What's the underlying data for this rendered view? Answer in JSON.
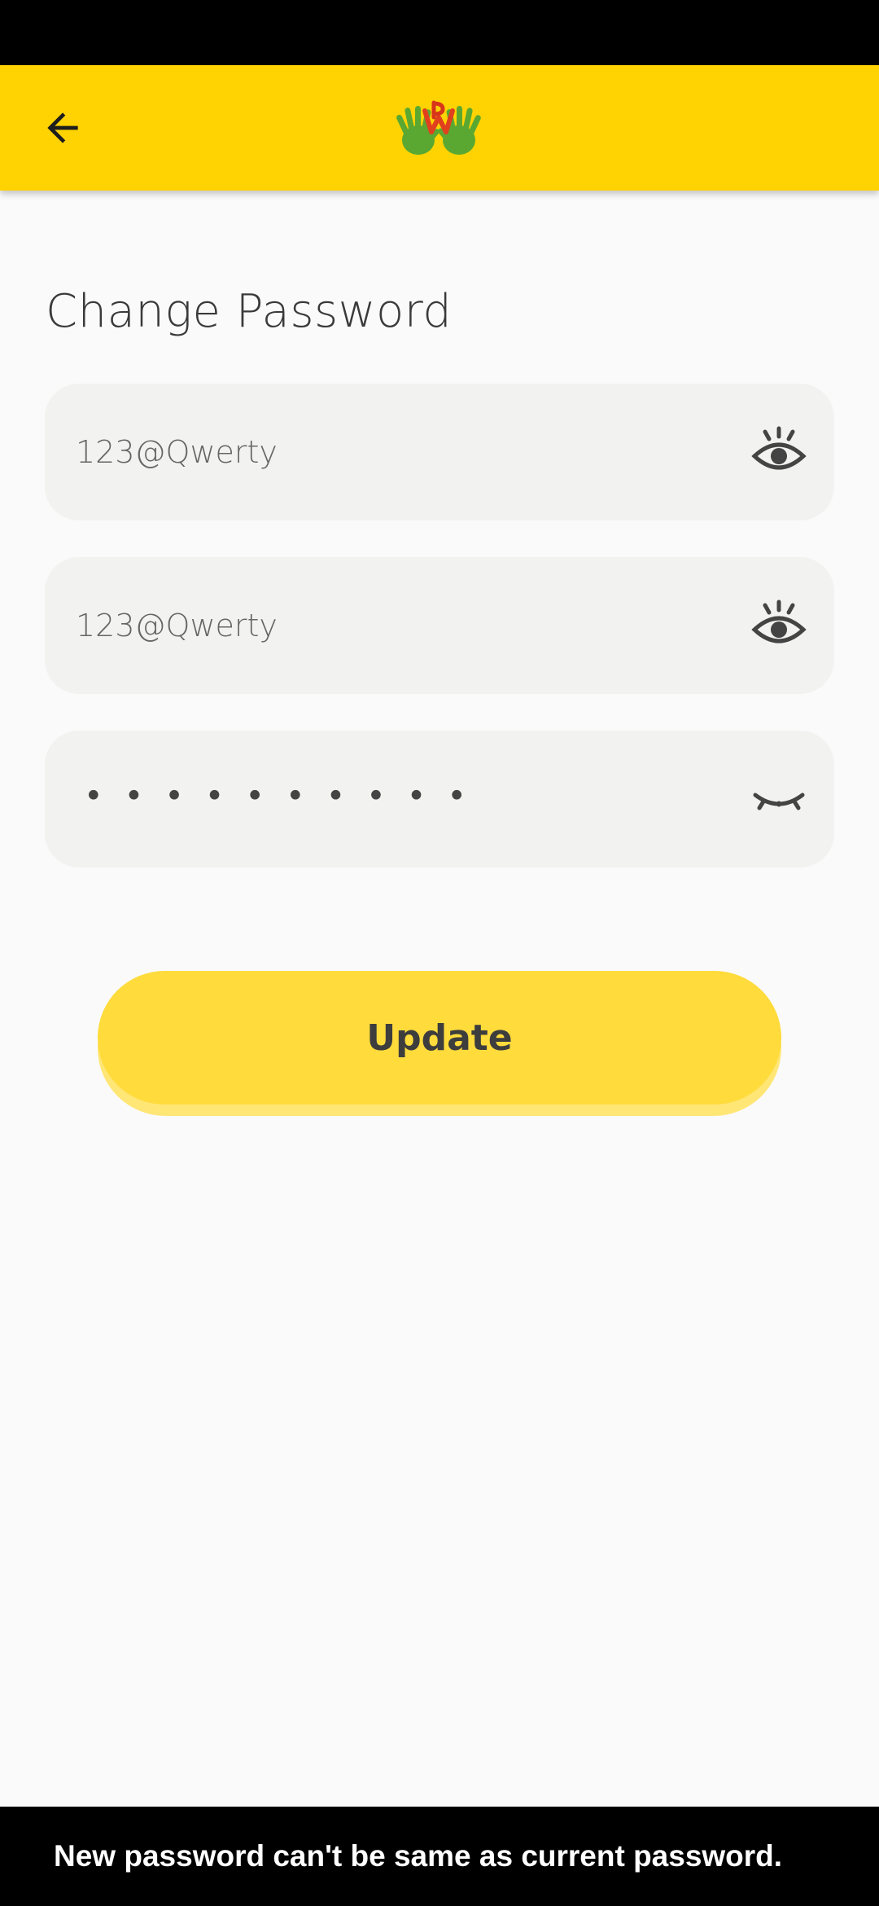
{
  "header": {
    "back_icon": "arrow-left-icon",
    "logo_icon": "hands-logo-icon",
    "brand_color": "#ffd302"
  },
  "page": {
    "title": "Change Password"
  },
  "fields": [
    {
      "value": "123@Qwerty",
      "visibility_icon": "eye-open-icon"
    },
    {
      "value": "123@Qwerty",
      "visibility_icon": "eye-open-icon"
    },
    {
      "value": "••••••••••",
      "visibility_icon": "eye-closed-icon"
    }
  ],
  "actions": {
    "update_label": "Update",
    "button_color": "#ffdb3c"
  },
  "snackbar": {
    "message": "New password can't be same as current password."
  }
}
